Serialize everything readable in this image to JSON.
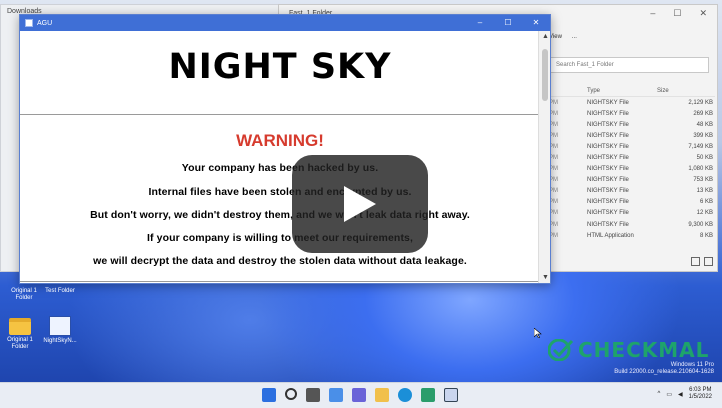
{
  "popup": {
    "window_title": "AGU",
    "headline": "NIGHT SKY",
    "warning": "WARNING!",
    "lines": [
      "Your company has been hacked by us.",
      "Internal files have been stolen and encrypted by us.",
      "But don't worry, we didn't destroy them, and we won't leak data right away.",
      "If your company is willing to meet our requirements,",
      "we will decrypt the data and destroy the stolen data without data leakage."
    ]
  },
  "explorer": {
    "window_title": "Fast_1 Folder",
    "toolbar_view": "View",
    "toolbar_more": "...",
    "search_placeholder": "Search Fast_1 Folder",
    "columns": [
      "Type",
      "Size"
    ],
    "rows": [
      {
        "date": "PM",
        "type": "NIGHTSKY File",
        "size": "2,129 KB"
      },
      {
        "date": "PM",
        "type": "NIGHTSKY File",
        "size": "269 KB"
      },
      {
        "date": "PM",
        "type": "NIGHTSKY File",
        "size": "48 KB"
      },
      {
        "date": "PM",
        "type": "NIGHTSKY File",
        "size": "399 KB"
      },
      {
        "date": "PM",
        "type": "NIGHTSKY File",
        "size": "7,149 KB"
      },
      {
        "date": "PM",
        "type": "NIGHTSKY File",
        "size": "50 KB"
      },
      {
        "date": "PM",
        "type": "NIGHTSKY File",
        "size": "1,080 KB"
      },
      {
        "date": "PM",
        "type": "NIGHTSKY File",
        "size": "753 KB"
      },
      {
        "date": "PM",
        "type": "NIGHTSKY File",
        "size": "13 KB"
      },
      {
        "date": "PM",
        "type": "NIGHTSKY File",
        "size": "6 KB"
      },
      {
        "date": "PM",
        "type": "NIGHTSKY File",
        "size": "12 KB"
      },
      {
        "date": "PM",
        "type": "NIGHTSKY File",
        "size": "9,300 KB"
      },
      {
        "date": "PM",
        "type": "HTML Application",
        "size": "8 KB"
      }
    ]
  },
  "bg_window": {
    "title": "Downloads"
  },
  "desktop": {
    "icons": [
      {
        "label": "Original 1 Folder"
      },
      {
        "label": "Test Folder"
      },
      {
        "label": "Original 1 Folder"
      },
      {
        "label": "NightSkyN..."
      }
    ],
    "watermark_brand": "CHECKMAL",
    "os_line1": "Windows 11 Pro",
    "os_line2": "Build 22000.co_release.210604-1628"
  },
  "taskbar": {
    "time": "6:03 PM",
    "date": "1/5/2022"
  },
  "colors": {
    "titlebar": "#3f6fd6",
    "warning_red": "#d63b2e",
    "brand_green": "#1ea36b"
  }
}
